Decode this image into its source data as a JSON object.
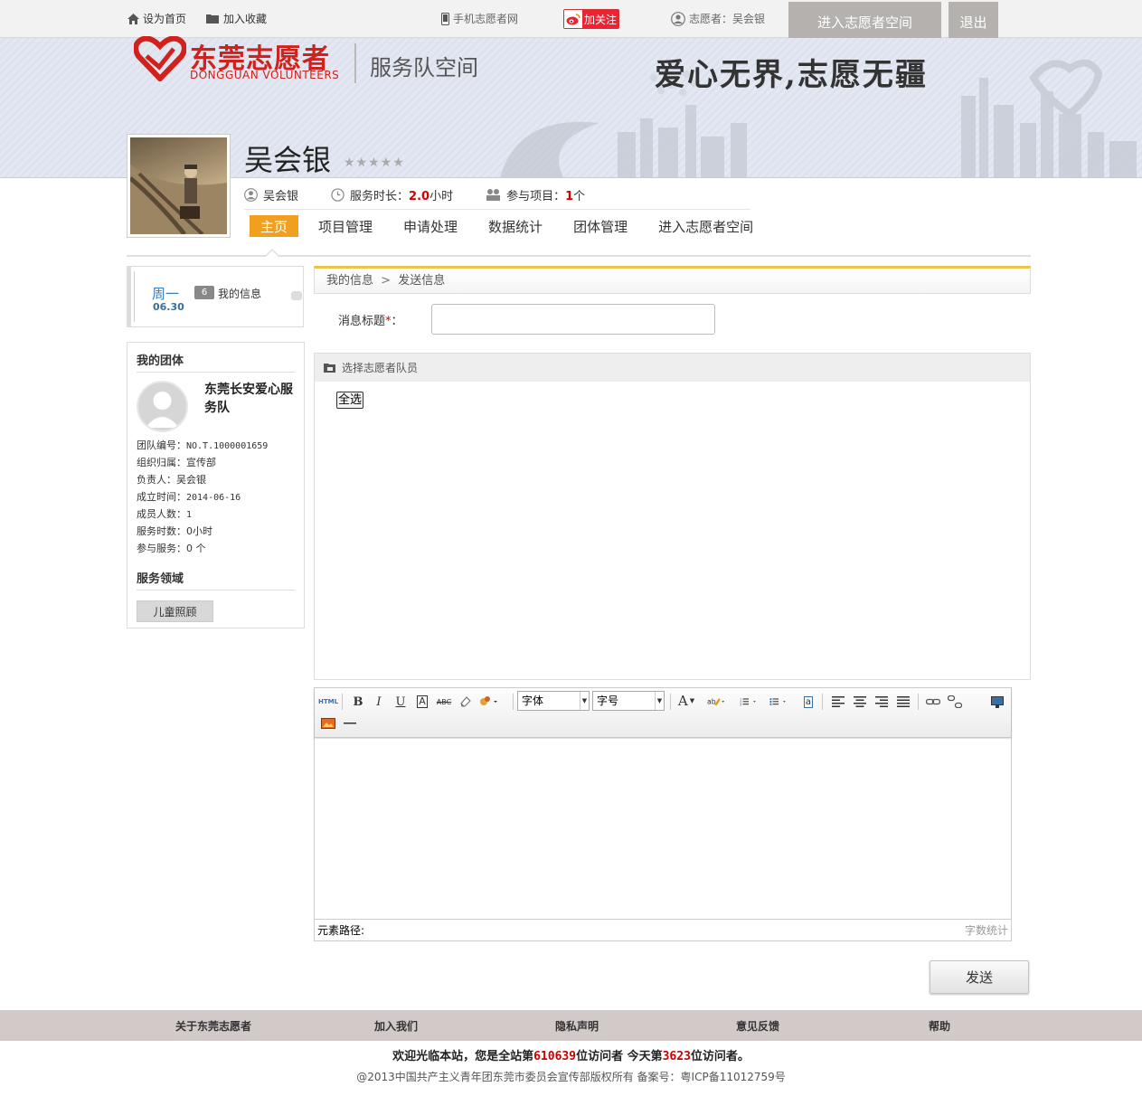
{
  "topbar": {
    "set_home": "设为首页",
    "add_fav": "加入收藏",
    "mobile_site": "手机志愿者网",
    "weibo_follow": "加关注",
    "user_label": "志愿者：吴会银",
    "enter_space": "进入志愿者空间",
    "logout": "退出"
  },
  "banner": {
    "logo_cn": "东莞志愿者",
    "logo_en": "DONGGUAN VOLUNTEERS",
    "space_title": "服务队空间",
    "slogan": "爱心无界,志愿无疆"
  },
  "profile": {
    "name": "吴会银",
    "stars": "★★★★★",
    "user_short": "吴会银",
    "hours_label": "服务时长：",
    "hours_value": "2.0",
    "hours_unit": "小时",
    "projects_label": "参与项目：",
    "projects_value": "1",
    "projects_unit": "个"
  },
  "nav": {
    "items": [
      "主页",
      "项目管理",
      "申请处理",
      "数据统计",
      "团体管理",
      "进入志愿者空间"
    ]
  },
  "date_widget": {
    "day": "周一",
    "date": "06.30",
    "badge": "6",
    "label": "我的信息"
  },
  "team": {
    "heading": "我的团体",
    "name": "东莞长安爱心服务队",
    "fields": [
      {
        "label": "团队编号：",
        "value": "NO.T.1000001659"
      },
      {
        "label": "组织归属：",
        "value": "宣传部"
      },
      {
        "label": "负责人：",
        "value": "吴会银"
      },
      {
        "label": "成立时间：",
        "value": "2014-06-16"
      },
      {
        "label": "成员人数：",
        "value": "1"
      },
      {
        "label": "服务时数：",
        "value": "0小时"
      },
      {
        "label": "参与服务：",
        "value": "0 个"
      }
    ],
    "area_heading": "服务领域",
    "area_tag": "儿童照顾"
  },
  "main": {
    "crumb_1": "我的信息",
    "crumb_sep": ">",
    "crumb_2": "发送信息",
    "title_label": "消息标题",
    "title_required": "*",
    "title_colon": "：",
    "title_value": "",
    "member_heading": "选择志愿者队员",
    "select_all": "全选"
  },
  "editor": {
    "html_btn": "HTML",
    "font_select": "字体",
    "size_select": "字号",
    "path_label": "元素路径:",
    "word_count": "字数统计"
  },
  "send_button": "发送",
  "footer": {
    "links": [
      "关于东莞志愿者",
      "加入我们",
      "隐私声明",
      "意见反馈",
      "帮助"
    ],
    "visit_prefix": "欢迎光临本站，您是全站第",
    "visit_total": "610639",
    "visit_mid": "位访问者 今天第",
    "visit_today": "3623",
    "visit_suffix": "位访问者。",
    "copyright": "@2013中国共产主义青年团东莞市委员会宣传部版权所有  备案号：粤ICP备11012759号"
  },
  "colors": {
    "brand_red": "#d0211c",
    "nav_active": "#f0a01e",
    "button_gray": "#b5b1ae",
    "footer_bar": "#d2c9c9"
  }
}
